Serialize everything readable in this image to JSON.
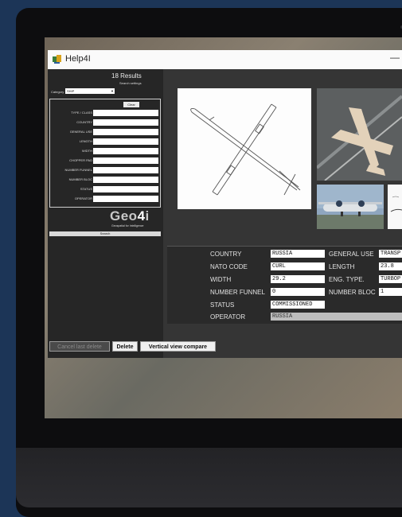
{
  "app": {
    "title": "Help4I",
    "minimize": "—"
  },
  "search": {
    "results_count": "18 Results",
    "settings_label": "Search settings",
    "category_label": "Category",
    "category_value": "SHIP",
    "clear_label": "Clear",
    "fields": [
      "TYPE / CLASS",
      "COUNTRY",
      "GENERAL USE",
      "LENGTH",
      "WIDTH",
      "CHOPPER PAD",
      "NUMBER FUNNEL",
      "NUMBER BLOC",
      "STATUS",
      "OPERATOR"
    ],
    "search_label": "Search"
  },
  "logo": {
    "geo": "Geo",
    "four": "4",
    "i": "i",
    "tagline": "Geospatial for Intelligence"
  },
  "buttons": {
    "cancel": "Cancel last delete",
    "delete": "Delete",
    "vertical": "Vertical view compare"
  },
  "details": {
    "country_label": "COUNTRY",
    "country": "RUSSIA",
    "general_use_label": "GENERAL USE",
    "general_use": "TRANSP",
    "nato_label": "NATO CODE",
    "nato": "CURL",
    "length_label": "LENGTH",
    "length": "23.8",
    "width_label": "WIDTH",
    "width": "29.2",
    "eng_label": "ENG. TYPE.",
    "eng": "TURBOP",
    "funnel_label": "NUMBER FUNNEL",
    "funnel": "0",
    "bloc_label": "NUMBER BLOC",
    "bloc": "1",
    "status_label": "STATUS",
    "status": "COMMISSIONED",
    "operator_label": "OPERATOR",
    "operator": "RUSSIA"
  }
}
